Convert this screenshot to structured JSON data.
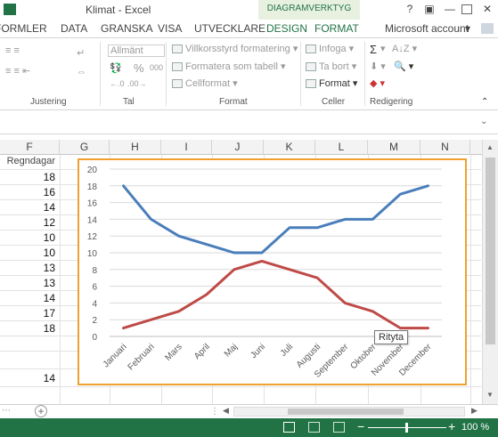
{
  "window": {
    "title": "Klimat - Excel",
    "help_label": "?",
    "account": "Microsoft account"
  },
  "tabs": [
    "FORMLER",
    "DATA",
    "GRANSKA",
    "VISA",
    "UTVECKLARE",
    "DESIGN",
    "FORMAT"
  ],
  "context_tab_group": "DIAGRAMVERKTYG",
  "ribbon": {
    "groups": {
      "justering": "Justering",
      "tal": "Tal",
      "format": "Format",
      "celler": "Celler",
      "redigering": "Redigering"
    },
    "number_format": "Allmänt",
    "percent": "%",
    "comma": "000",
    "cond_format": "Villkorsstyrd formatering",
    "format_table": "Formatera som tabell",
    "cell_style": "Cellformat",
    "insert": "Infoga",
    "delete": "Ta bort",
    "format": "Format",
    "sum": "Σ"
  },
  "columns": [
    "F",
    "G",
    "H",
    "I",
    "J",
    "K",
    "L",
    "M",
    "N"
  ],
  "column_f": {
    "header_cell": "Regndagar",
    "values": [
      "18",
      "16",
      "14",
      "12",
      "10",
      "10",
      "13",
      "13",
      "14",
      "17",
      "18",
      "",
      "14"
    ]
  },
  "tooltip": "Rityta",
  "status": {
    "zoom": "100 %"
  },
  "chart_data": {
    "type": "line",
    "categories": [
      "Januari",
      "Februari",
      "Mars",
      "April",
      "Maj",
      "Juni",
      "Juli",
      "Augusti",
      "September",
      "Oktober",
      "November",
      "December"
    ],
    "series": [
      {
        "values": [
          18,
          14,
          12,
          11,
          10,
          10,
          13,
          13,
          14,
          14,
          17,
          18
        ],
        "color": "#4a7ebb"
      },
      {
        "values": [
          1,
          2,
          3,
          5,
          8,
          9,
          8,
          7,
          4,
          3,
          1,
          1
        ],
        "color": "#be4b48"
      }
    ],
    "ylim": [
      0,
      20
    ],
    "yticks": [
      0,
      2,
      4,
      6,
      8,
      10,
      12,
      14,
      16,
      18,
      20
    ],
    "grid": true
  }
}
